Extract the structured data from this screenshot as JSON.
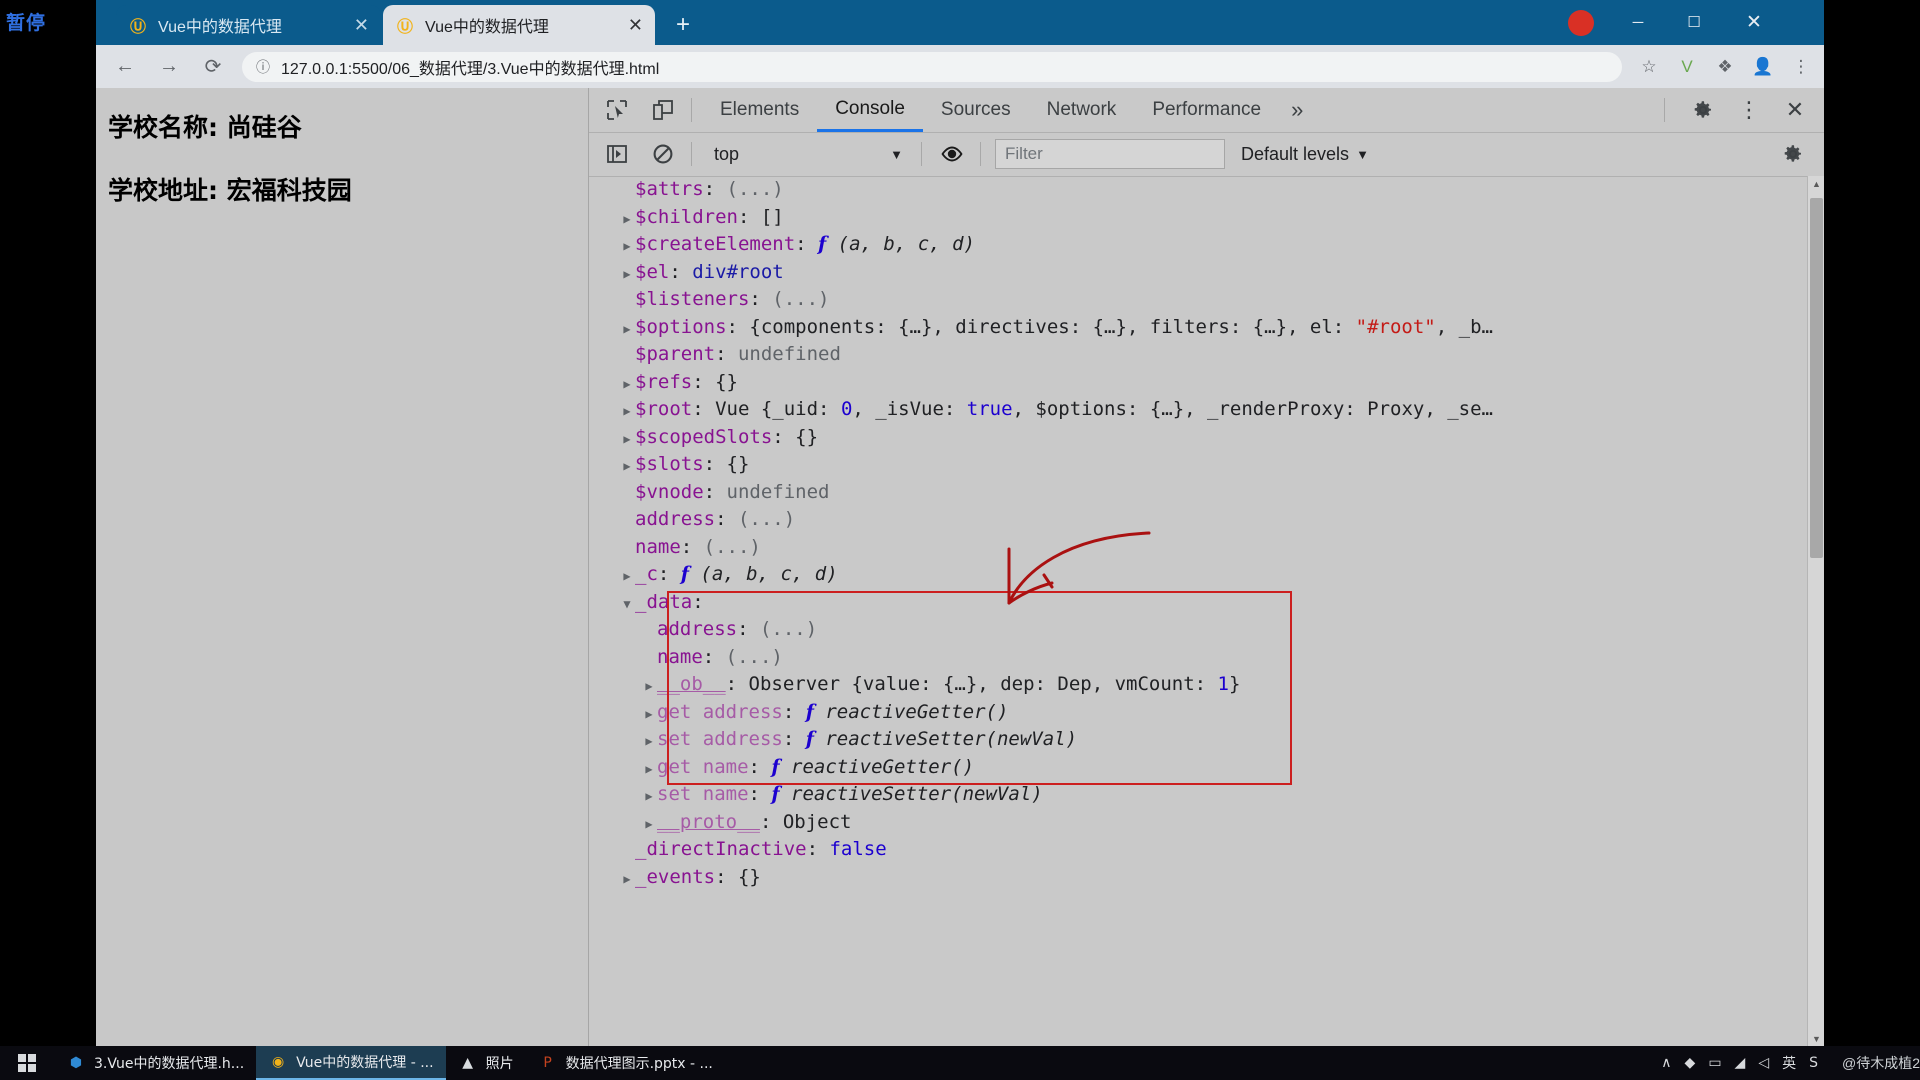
{
  "recorder": {
    "label": "暂停"
  },
  "browser": {
    "tabs": [
      {
        "title": "Vue中的数据代理",
        "favicon": "vue-logo-icon",
        "active": false
      },
      {
        "title": "Vue中的数据代理",
        "favicon": "vue-logo-icon",
        "active": true
      }
    ],
    "new_tab_label": "+",
    "window_controls": {
      "minimize": "─",
      "maximize": "☐",
      "close": "✕"
    },
    "toolbar": {
      "back": "←",
      "forward": "→",
      "reload": "⟳",
      "info_icon": "ⓘ",
      "url": "127.0.0.1:5500/06_数据代理/3.Vue中的数据代理.html",
      "star": "☆",
      "ext_v": "V",
      "ext_puzzle": "❖",
      "profile": "●",
      "menu": "⋮"
    }
  },
  "page": {
    "lines": [
      "学校名称: 尚硅谷",
      "学校地址: 宏福科技园"
    ]
  },
  "devtools": {
    "inspect_icon": "cursor-select-icon",
    "device_icon": "device-toolbar-icon",
    "tabs": [
      {
        "label": "Elements",
        "selected": false
      },
      {
        "label": "Console",
        "selected": true
      },
      {
        "label": "Sources",
        "selected": false
      },
      {
        "label": "Network",
        "selected": false
      },
      {
        "label": "Performance",
        "selected": false
      }
    ],
    "more_tabs": "»",
    "settings_icon": "gear-icon",
    "kebab_icon": "⋮",
    "close_icon": "✕",
    "console_bar": {
      "sidebar_toggle": "console-sidebar-icon",
      "clear": "clear-console-icon",
      "context": "top",
      "context_caret": "▼",
      "eye_icon": "live-expression-icon",
      "filter_placeholder": "Filter",
      "levels": "Default levels",
      "levels_caret": "▼",
      "console_settings_icon": "gear-icon"
    },
    "scrollbar": {
      "up": "▲",
      "down": "▼"
    },
    "rows": [
      {
        "indent": 1,
        "tri": "",
        "key": "$attrs",
        "keyclass": "k",
        "sep": ": ",
        "parts": [
          {
            "t": "(...)",
            "c": "dim"
          }
        ]
      },
      {
        "indent": 1,
        "tri": "▶",
        "key": "$children",
        "keyclass": "k",
        "sep": ": ",
        "parts": [
          {
            "t": "[]",
            "c": "v-obj"
          }
        ]
      },
      {
        "indent": 1,
        "tri": "▶",
        "key": "$createElement",
        "keyclass": "k",
        "sep": ": ",
        "parts": [
          {
            "t": "f",
            "c": "fn-f"
          },
          {
            "t": " (a, b, c, d)",
            "c": "fn-sig"
          }
        ]
      },
      {
        "indent": 1,
        "tri": "▶",
        "key": "$el",
        "keyclass": "k",
        "sep": ": ",
        "parts": [
          {
            "t": "div#root",
            "c": "v-node"
          }
        ]
      },
      {
        "indent": 1,
        "tri": "",
        "key": "$listeners",
        "keyclass": "k",
        "sep": ": ",
        "parts": [
          {
            "t": "(...)",
            "c": "dim"
          }
        ]
      },
      {
        "indent": 1,
        "tri": "▶",
        "key": "$options",
        "keyclass": "k",
        "sep": ": ",
        "parts": [
          {
            "t": "{components: {…}, directives: {…}, filters: {…}, el: ",
            "c": "v-obj"
          },
          {
            "t": "\"#root\"",
            "c": "v-str"
          },
          {
            "t": ", _b…",
            "c": "v-obj"
          }
        ]
      },
      {
        "indent": 1,
        "tri": "",
        "key": "$parent",
        "keyclass": "k",
        "sep": ": ",
        "parts": [
          {
            "t": "undefined",
            "c": "v-undef"
          }
        ]
      },
      {
        "indent": 1,
        "tri": "▶",
        "key": "$refs",
        "keyclass": "k",
        "sep": ": ",
        "parts": [
          {
            "t": "{}",
            "c": "v-obj"
          }
        ]
      },
      {
        "indent": 1,
        "tri": "▶",
        "key": "$root",
        "keyclass": "k",
        "sep": ": ",
        "parts": [
          {
            "t": "Vue {_uid: ",
            "c": "v-obj"
          },
          {
            "t": "0",
            "c": "v-num"
          },
          {
            "t": ", _isVue: ",
            "c": "v-obj"
          },
          {
            "t": "true",
            "c": "v-bool"
          },
          {
            "t": ", $options: {…}, _renderProxy: Proxy, _se…",
            "c": "v-obj"
          }
        ]
      },
      {
        "indent": 1,
        "tri": "▶",
        "key": "$scopedSlots",
        "keyclass": "k",
        "sep": ": ",
        "parts": [
          {
            "t": "{}",
            "c": "v-obj"
          }
        ]
      },
      {
        "indent": 1,
        "tri": "▶",
        "key": "$slots",
        "keyclass": "k",
        "sep": ": ",
        "parts": [
          {
            "t": "{}",
            "c": "v-obj"
          }
        ]
      },
      {
        "indent": 1,
        "tri": "",
        "key": "$vnode",
        "keyclass": "k",
        "sep": ": ",
        "parts": [
          {
            "t": "undefined",
            "c": "v-undef"
          }
        ]
      },
      {
        "indent": 1,
        "tri": "",
        "key": "address",
        "keyclass": "k",
        "sep": ": ",
        "parts": [
          {
            "t": "(...)",
            "c": "dim"
          }
        ]
      },
      {
        "indent": 1,
        "tri": "",
        "key": "name",
        "keyclass": "k",
        "sep": ": ",
        "parts": [
          {
            "t": "(...)",
            "c": "dim"
          }
        ]
      },
      {
        "indent": 1,
        "tri": "▶",
        "key": "_c",
        "keyclass": "k",
        "sep": ": ",
        "parts": [
          {
            "t": "f",
            "c": "fn-f"
          },
          {
            "t": " (a, b, c, d)",
            "c": "fn-sig"
          }
        ]
      },
      {
        "indent": 1,
        "tri": "▼",
        "key": "_data",
        "keyclass": "k",
        "sep": ":",
        "parts": []
      },
      {
        "indent": 2,
        "tri": "",
        "key": "address",
        "keyclass": "k",
        "sep": ": ",
        "parts": [
          {
            "t": "(...)",
            "c": "dim"
          }
        ]
      },
      {
        "indent": 2,
        "tri": "",
        "key": "name",
        "keyclass": "k",
        "sep": ": ",
        "parts": [
          {
            "t": "(...)",
            "c": "dim"
          }
        ]
      },
      {
        "indent": 2,
        "tri": "▶",
        "key": "__ob__",
        "keyclass": "k-light",
        "sep": ": ",
        "parts": [
          {
            "t": "Observer {value: {…}, dep: Dep, vmCount: ",
            "c": "v-obj"
          },
          {
            "t": "1",
            "c": "v-num"
          },
          {
            "t": "}",
            "c": "v-obj"
          }
        ]
      },
      {
        "indent": 2,
        "tri": "▶",
        "key": "get address",
        "keyclass": "accessor",
        "sep": ": ",
        "parts": [
          {
            "t": "f",
            "c": "fn-f"
          },
          {
            "t": " reactiveGetter()",
            "c": "fn-name"
          }
        ]
      },
      {
        "indent": 2,
        "tri": "▶",
        "key": "set address",
        "keyclass": "accessor",
        "sep": ": ",
        "parts": [
          {
            "t": "f",
            "c": "fn-f"
          },
          {
            "t": " reactiveSetter(newVal)",
            "c": "fn-name"
          }
        ]
      },
      {
        "indent": 2,
        "tri": "▶",
        "key": "get name",
        "keyclass": "accessor",
        "sep": ": ",
        "parts": [
          {
            "t": "f",
            "c": "fn-f"
          },
          {
            "t": " reactiveGetter()",
            "c": "fn-name"
          }
        ]
      },
      {
        "indent": 2,
        "tri": "▶",
        "key": "set name",
        "keyclass": "accessor",
        "sep": ": ",
        "parts": [
          {
            "t": "f",
            "c": "fn-f"
          },
          {
            "t": " reactiveSetter(newVal)",
            "c": "fn-name"
          }
        ]
      },
      {
        "indent": 2,
        "tri": "▶",
        "key": "__proto__",
        "keyclass": "k-light",
        "sep": ": ",
        "parts": [
          {
            "t": "Object",
            "c": "v-obj"
          }
        ]
      },
      {
        "indent": 1,
        "tri": "",
        "key": "_directInactive",
        "keyclass": "k",
        "sep": ": ",
        "parts": [
          {
            "t": "false",
            "c": "v-bool"
          }
        ]
      },
      {
        "indent": 1,
        "tri": "▶",
        "key": "_events",
        "keyclass": "k",
        "sep": ": ",
        "parts": [
          {
            "t": "{}",
            "c": "v-obj"
          }
        ]
      }
    ],
    "annotation": {
      "color": "#cc1f1f",
      "shape": "hand-drawn-arrow-and-box"
    }
  },
  "taskbar": {
    "start_icon": "windows-logo-icon",
    "items": [
      {
        "icon": "vscode-icon",
        "icon_glyph": "⬢",
        "icon_color": "#2f8ad4",
        "label": "3.Vue中的数据代理.h...",
        "active": false
      },
      {
        "icon": "chrome-icon",
        "icon_glyph": "◉",
        "icon_color": "#f2b31a",
        "label": "Vue中的数据代理 - ...",
        "active": true
      },
      {
        "icon": "photos-icon",
        "icon_glyph": "▲",
        "icon_color": "#d9dde0",
        "label": "照片",
        "active": false
      },
      {
        "icon": "powerpoint-icon",
        "icon_glyph": "P",
        "icon_color": "#c5431f",
        "label": "数据代理图示.pptx - ...",
        "active": false
      }
    ],
    "tray": [
      {
        "name": "chevron-up-icon",
        "glyph": "∧"
      },
      {
        "name": "security-icon",
        "glyph": "◆"
      },
      {
        "name": "battery-icon",
        "glyph": "▭"
      },
      {
        "name": "network-icon",
        "glyph": "◢"
      },
      {
        "name": "volume-icon",
        "glyph": "◁"
      },
      {
        "name": "ime-icon",
        "glyph": "英"
      },
      {
        "name": "ime-mode-icon",
        "glyph": "S"
      }
    ],
    "watermark": "@待木成植2"
  }
}
